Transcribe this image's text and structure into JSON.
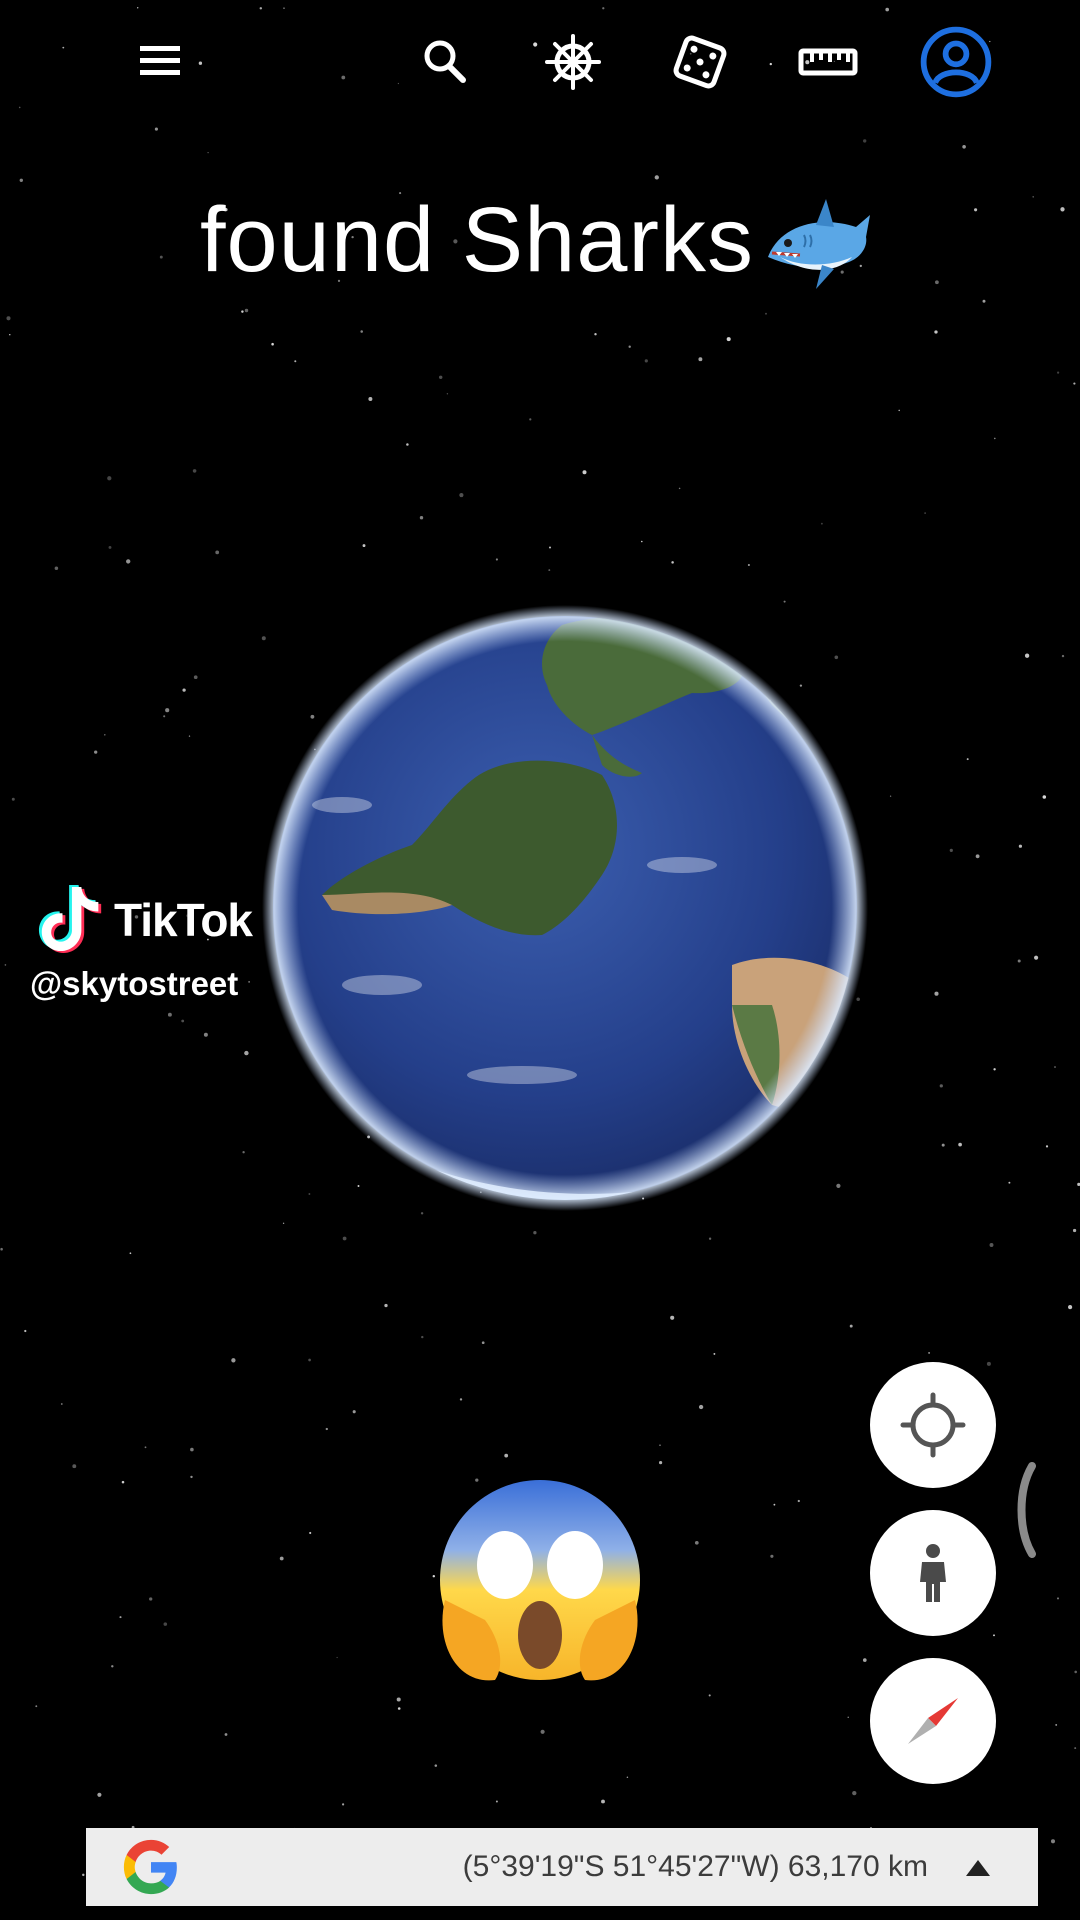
{
  "toolbar": {
    "items": [
      {
        "name": "menu",
        "icon": "hamburger-menu-icon"
      },
      {
        "name": "search",
        "icon": "search-icon"
      },
      {
        "name": "voyager",
        "icon": "ship-wheel-icon"
      },
      {
        "name": "feeling-lucky",
        "icon": "dice-icon"
      },
      {
        "name": "measure",
        "icon": "ruler-icon"
      },
      {
        "name": "account",
        "icon": "account-circle-icon"
      }
    ],
    "icon_color": "#ffffff",
    "account_color": "#1e6fe0"
  },
  "overlay": {
    "title": "found Sharks",
    "title_emoji": "shark-emoji",
    "reaction_emoji": "face-screaming-in-fear-emoji"
  },
  "watermark": {
    "brand": "TikTok",
    "handle": "@skytostreet"
  },
  "map_controls": [
    {
      "name": "my-location",
      "icon": "crosshair-icon"
    },
    {
      "name": "street-view",
      "icon": "pegman-icon"
    },
    {
      "name": "compass",
      "icon": "compass-needle-icon"
    }
  ],
  "status_bar": {
    "logo": "google-g-logo",
    "coordinates": "(5°39'19\"S 51°45'27\"W) 63,170 km",
    "expand_icon": "triangle-up-icon"
  },
  "colors": {
    "background": "#000000",
    "status_bar_bg": "#ededed",
    "ocean": "#2b4a96",
    "land": "#3d5a2e"
  }
}
